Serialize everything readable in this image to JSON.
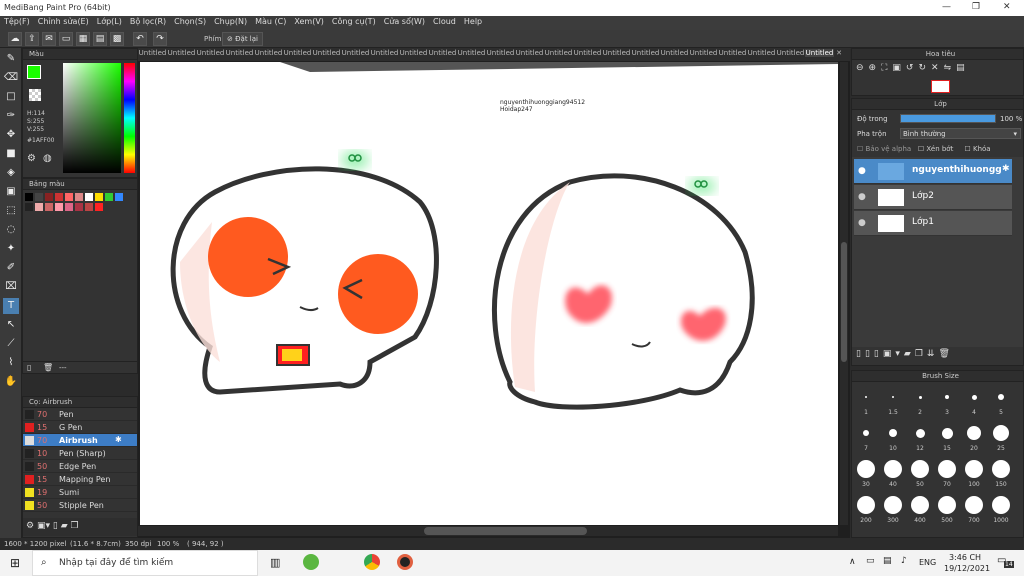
{
  "app": {
    "title": "MediBang Paint Pro (64bit)"
  },
  "menu": [
    "Tệp(F)",
    "Chỉnh sửa(E)",
    "Lớp(L)",
    "Bộ lọc(R)",
    "Chọn(S)",
    "Chụp(N)",
    "Màu (C)",
    "Xem(V)",
    "Công cụ(T)",
    "Cửa sổ(W)",
    "Cloud",
    "Help"
  ],
  "toolbar": {
    "key_label": "Phím",
    "reset_label": "Đặt lại"
  },
  "color_panel": {
    "title": "Màu",
    "h": "H:114",
    "s": "S:255",
    "v": "V:255",
    "hex": "#1AFF00",
    "fg_color": "#1aff00"
  },
  "swatch_panel": {
    "title": "Bảng màu",
    "footer": "---"
  },
  "brush_panel": {
    "title": "Cọ: Airbrush",
    "items": [
      {
        "size": "70",
        "name": "Pen",
        "color": "#222222"
      },
      {
        "size": "15",
        "name": "G Pen",
        "color": "#e02020"
      },
      {
        "size": "70",
        "name": "Airbrush",
        "color": "#dddddd"
      },
      {
        "size": "10",
        "name": "Pen (Sharp)",
        "color": "#222222"
      },
      {
        "size": "50",
        "name": "Edge Pen",
        "color": "#222222"
      },
      {
        "size": "15",
        "name": "Mapping Pen",
        "color": "#e02020"
      },
      {
        "size": "19",
        "name": "Sumi",
        "color": "#f0e020"
      },
      {
        "size": "50",
        "name": "Stipple Pen",
        "color": "#f0e020"
      }
    ]
  },
  "tabs": [
    "Untitled",
    "Untitled",
    "Untitled",
    "Untitled",
    "Untitled",
    "Untitled",
    "Untitled",
    "Untitled",
    "Untitled",
    "Untitled",
    "Untitled",
    "Untitled",
    "Untitled",
    "Untitled",
    "Untitled",
    "Untitled",
    "Untitled",
    "Untitled",
    "Untitled",
    "Untitled",
    "Untitled",
    "Untitled",
    "Untitled",
    "Untitled"
  ],
  "canvas": {
    "watermark": "nguyenthihuonggiang94512",
    "watermark2": "Hoidap247"
  },
  "nav_panel": {
    "title": "Hoa tiêu"
  },
  "layer_panel": {
    "title": "Lớp",
    "opacity_label": "Độ trong",
    "opacity_value": "100 %",
    "opacity": 1.0,
    "blend_label": "Pha trộn",
    "blend_value": "Bình thường",
    "protect_alpha": "Bảo vệ alpha",
    "clipping": "Xén bớt",
    "lock": "Khóa",
    "layers": [
      {
        "name": "nguyenthihuonggian"
      },
      {
        "name": "Lớp2"
      },
      {
        "name": "Lớp1"
      }
    ]
  },
  "brush_size_panel": {
    "title": "Brush Size",
    "sizes": [
      "1",
      "1.5",
      "2",
      "3",
      "4",
      "5",
      "7",
      "10",
      "12",
      "15",
      "20",
      "25",
      "30",
      "40",
      "50",
      "70",
      "100",
      "150",
      "200",
      "300",
      "400",
      "500",
      "700",
      "1000"
    ]
  },
  "status": {
    "dims": "1600 * 1200 pixel",
    "cm": "(11.6 * 8.7cm)",
    "dpi": "350 dpi",
    "zoom": "100 %",
    "coords": "( 944, 92 )"
  },
  "taskbar": {
    "search": "Nhập tại đây để tìm kiếm",
    "lang": "ENG",
    "time": "3:46 CH",
    "date": "19/12/2021",
    "notif": "14"
  }
}
